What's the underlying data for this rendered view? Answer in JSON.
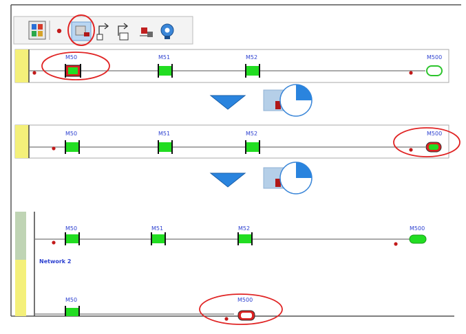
{
  "toolbar": {
    "buttons": [
      {
        "icon": "ladder-grid-icon"
      },
      {
        "icon": "red-dot-icon"
      },
      {
        "icon": "online-monitor-icon"
      },
      {
        "icon": "step-into-icon"
      },
      {
        "icon": "step-over-icon"
      },
      {
        "icon": "step-out-icon"
      },
      {
        "icon": "plc-probe-icon"
      }
    ]
  },
  "panel1": {
    "contacts": [
      {
        "label": "M50"
      },
      {
        "label": "M51"
      },
      {
        "label": "M52"
      }
    ],
    "coil": {
      "label": "M500"
    }
  },
  "panel2": {
    "contacts": [
      {
        "label": "M50"
      },
      {
        "label": "M51"
      },
      {
        "label": "M52"
      }
    ],
    "coil": {
      "label": "M500"
    }
  },
  "panel3": {
    "row1": {
      "contacts": [
        {
          "label": "M50"
        },
        {
          "label": "M51"
        },
        {
          "label": "M52"
        }
      ],
      "coil": {
        "label": "M500"
      }
    },
    "network_label": "Network 2",
    "row2": {
      "contact": {
        "label": "M50"
      },
      "coil": {
        "label": "M500"
      }
    }
  },
  "colors": {
    "contact_green": "#22dd22",
    "active_red": "#dd2222",
    "rail_yellow": "#f4f07a",
    "rail_green": "#bfd4b4",
    "arrow_blue": "#2a84de",
    "highlight_ellipse": "#e02424",
    "label_blue": "#2b3fd0"
  }
}
